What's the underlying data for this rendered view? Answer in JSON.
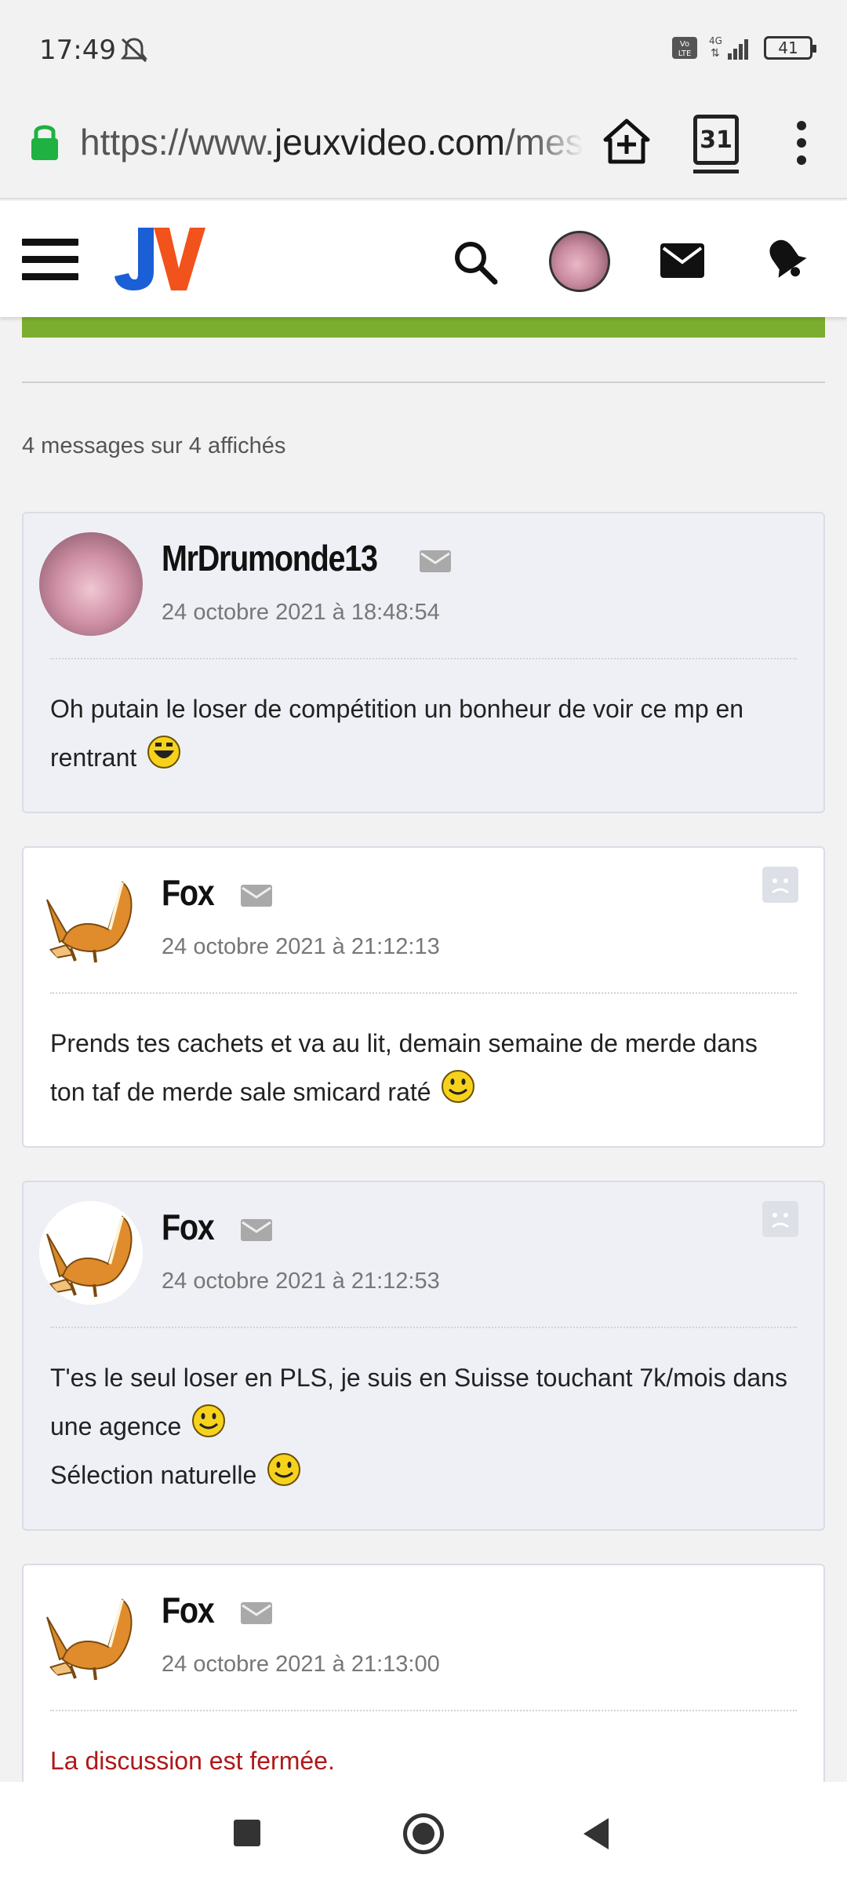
{
  "status_bar": {
    "time": "17:49",
    "network": "4G",
    "volte": "Vo LTE",
    "battery": "41"
  },
  "browser": {
    "url_prefix": "https://www.",
    "url_host": "jeuxvideo.com",
    "url_suffix": "/mes",
    "tab_count": "31"
  },
  "header": {
    "logo": "JV"
  },
  "thread": {
    "count_label": "4 messages sur 4 affichés",
    "messages": [
      {
        "author": "MrDrumonde13",
        "date": "24 octobre 2021 à 18:48:54",
        "lines": [
          "Oh putain le loser de compétition un bonheur de voir ce mp en",
          "rentrant"
        ],
        "smiley": "laugh-smiley-icon"
      },
      {
        "author": "Fox",
        "date": "24 octobre 2021 à 21:12:13",
        "lines": [
          "Prends tes cachets et va au lit, demain semaine de merde dans",
          "ton taf de merde sale smicard raté"
        ],
        "smiley": "smile-smiley-icon"
      },
      {
        "author": "Fox",
        "date": "24 octobre 2021 à 21:12:53",
        "lines": [
          "T'es le seul loser en PLS, je suis en Suisse touchant 7k/mois dans",
          "une agence",
          "Sélection naturelle"
        ],
        "smiley": "smile-smiley-icon"
      },
      {
        "author": "Fox",
        "date": "24 octobre 2021 à 21:13:00",
        "closed_notice": "La discussion est fermée."
      }
    ]
  },
  "colors": {
    "accent_green": "#7bae2e",
    "logo_blue": "#1a5fd6",
    "logo_orange": "#f2521c",
    "closed_red": "#b01818"
  }
}
